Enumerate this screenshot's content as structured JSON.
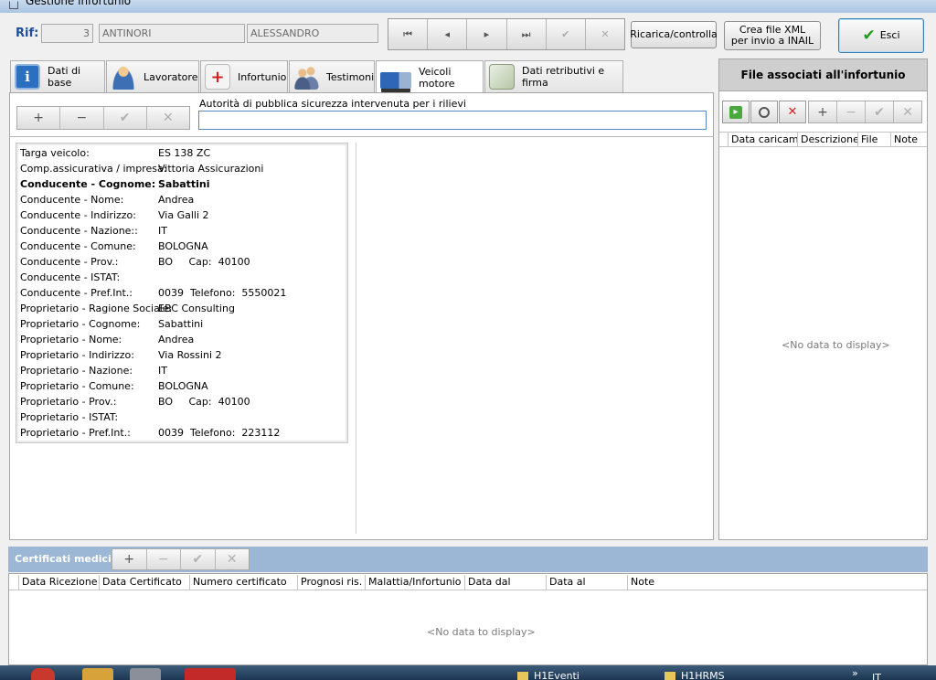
{
  "window": {
    "title": "Gestione infortunio"
  },
  "header": {
    "rif_label": "Rif:",
    "rif_number": "3",
    "surname": "ANTINORI",
    "name": "ALESSANDRO",
    "nav": {
      "first": "⏮",
      "prev": "◂",
      "next": "▸",
      "last": "⏭",
      "confirm": "✔",
      "cancel": "✕"
    },
    "ricarica_label": "Ricarica/controlla",
    "xml_label": "Crea file XML per invio a INAIL",
    "esci_label": "Esci"
  },
  "tabs": [
    {
      "label": "Dati di base",
      "icon": "info-icon"
    },
    {
      "label": "Lavoratore",
      "icon": "worker-icon"
    },
    {
      "label": "Infortunio",
      "icon": "first-aid-icon"
    },
    {
      "label": "Testimoni",
      "icon": "people-icon"
    },
    {
      "label": "Veicoli motore",
      "icon": "truck-icon"
    },
    {
      "label": "Dati retributivi e firma",
      "icon": "money-icon"
    }
  ],
  "vehicle": {
    "toolbar": {
      "add": "+",
      "remove": "−",
      "confirm": "✔",
      "cancel": "✕"
    },
    "authority_label": "Autorità di pubblica sicurezza intervenuta per i rilievi",
    "authority_value": "",
    "details": [
      {
        "label": "Targa veicolo:",
        "value": "ES 138 ZC",
        "bold": false
      },
      {
        "label": "Comp.assicurativa / impresa:",
        "value": "Vittoria Assicurazioni",
        "bold": false
      },
      {
        "label": "Conducente - Cognome:",
        "value": "Sabattini",
        "bold": true
      },
      {
        "label": "Conducente - Nome:",
        "value": "Andrea",
        "bold": false
      },
      {
        "label": "Conducente - Indirizzo:",
        "value": "Via Galli 2",
        "bold": false
      },
      {
        "label": "Conducente - Nazione::",
        "value": "IT",
        "bold": false
      },
      {
        "label": "Conducente - Comune:",
        "value": "BOLOGNA",
        "bold": false
      },
      {
        "label": "Conducente - Prov.:",
        "value": "BO     Cap:  40100",
        "bold": false
      },
      {
        "label": "Conducente - ISTAT:",
        "value": "",
        "bold": false
      },
      {
        "label": "Conducente - Pref.Int.:",
        "value": "0039  Telefono:  5550021",
        "bold": false
      },
      {
        "label": "Proprietario - Ragione Sociale:",
        "value": "EBC Consulting",
        "bold": false
      },
      {
        "label": "Proprietario - Cognome:",
        "value": "Sabattini",
        "bold": false
      },
      {
        "label": "Proprietario - Nome:",
        "value": "Andrea",
        "bold": false
      },
      {
        "label": "Proprietario - Indirizzo:",
        "value": "Via Rossini 2",
        "bold": false
      },
      {
        "label": "Proprietario - Nazione:",
        "value": "IT",
        "bold": false
      },
      {
        "label": "Proprietario - Comune:",
        "value": "BOLOGNA",
        "bold": false
      },
      {
        "label": "Proprietario - Prov.:",
        "value": "BO     Cap:  40100",
        "bold": false
      },
      {
        "label": "Proprietario - ISTAT:",
        "value": "",
        "bold": false
      },
      {
        "label": "Proprietario - Pref.Int.:",
        "value": "0039  Telefono:  223112",
        "bold": false
      }
    ]
  },
  "files": {
    "title": "File associati all'infortunio",
    "toolbar": {
      "add": "+",
      "remove": "−",
      "confirm": "✔",
      "cancel": "✕"
    },
    "columns": [
      "Data caricam.",
      "Descrizione",
      "File",
      "Note"
    ],
    "empty": "<No data to display>"
  },
  "certificates": {
    "title": "Certificati medici",
    "toolbar": {
      "add": "+",
      "remove": "−",
      "confirm": "✔",
      "cancel": "✕"
    },
    "columns": [
      "Data Ricezione",
      "Data Certificato",
      "Numero certificato",
      "Prognosi ris.",
      "Malattia/Infortunio",
      "Data dal",
      "Data al",
      "Note"
    ],
    "empty": "<No data to display>"
  },
  "taskbar": {
    "items": [
      "H1Eventi",
      "H1HRMS"
    ],
    "lang": "IT",
    "more": "»"
  },
  "colors": {
    "accent": "#1d4f9a",
    "section_bar": "#9cb6d6",
    "files_header": "#cfcfcf",
    "taskbar": "#1c3652"
  }
}
